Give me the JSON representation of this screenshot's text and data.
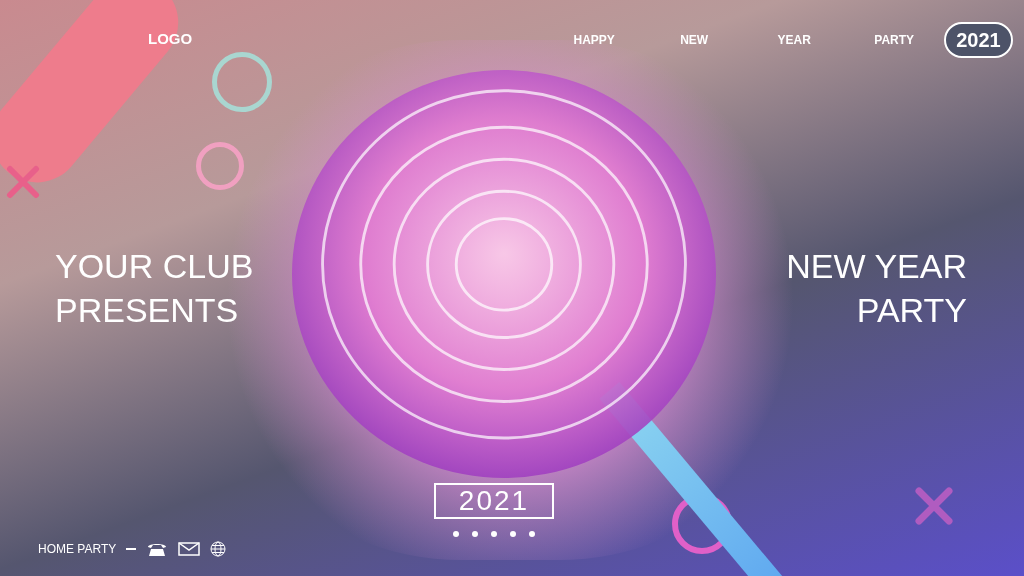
{
  "header": {
    "logo": "LOGO",
    "nav": [
      "HAPPY",
      "NEW",
      "YEAR",
      "PARTY"
    ],
    "year_badge": "2021"
  },
  "hero": {
    "left_title": [
      "YOUR CLUB",
      "PRESENTS"
    ],
    "right_title": [
      "NEW YEAR",
      "PARTY"
    ],
    "year_button": "2021"
  },
  "footer": {
    "text": "HOME PARTY"
  }
}
